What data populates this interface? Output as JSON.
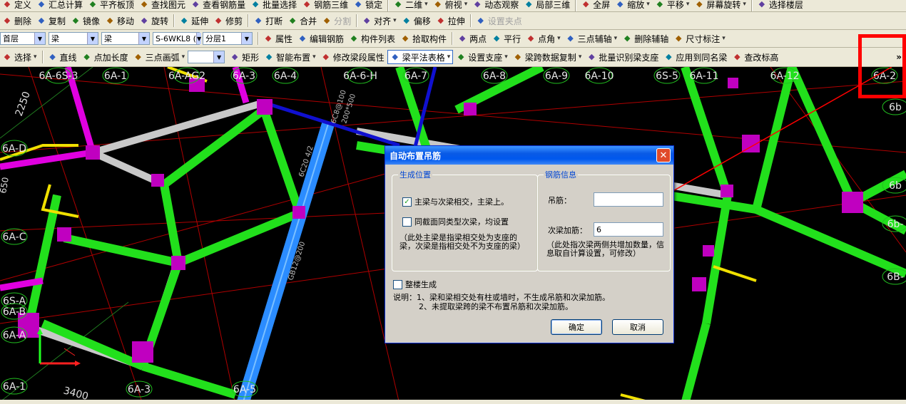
{
  "toolbar_top": {
    "items": [
      "定义",
      "汇总计算",
      "平齐板顶",
      "查找图元",
      "查看钢筋量",
      "批量选择",
      "钢筋三维",
      "锁定",
      "二维",
      "俯视",
      "动态观察",
      "局部三维",
      "全屏",
      "缩放",
      "平移",
      "屏幕旋转",
      "选择楼层"
    ]
  },
  "toolbar_edit": {
    "items": [
      "删除",
      "复制",
      "镜像",
      "移动",
      "旋转",
      "延伸",
      "修剪",
      "打断",
      "合并",
      "分割",
      "对齐",
      "偏移",
      "拉伸",
      "设置夹点"
    ]
  },
  "toolbar_props": {
    "combos": [
      "首层",
      "梁",
      "梁",
      "S-6WKL8 (",
      "分层1"
    ],
    "items": [
      "属性",
      "编辑钢筋",
      "构件列表",
      "拾取构件",
      "两点",
      "平行",
      "点角",
      "三点辅轴",
      "删除辅轴",
      "尺寸标注"
    ]
  },
  "toolbar_draw": {
    "items": [
      "选择",
      "直线",
      "点加长度",
      "三点画弧",
      "矩形",
      "智能布置",
      "修改梁段属性",
      "梁平法表格",
      "设置支座",
      "梁跨数据复制",
      "批量识别梁支座",
      "应用到同名梁",
      "查改标高"
    ],
    "overflow": "»"
  },
  "canvas": {
    "axis_labels_top": [
      "6A-6S-3",
      "6A-1",
      "6A-AG2",
      "6A-3",
      "6A-4",
      "6A-6-H",
      "6A-7",
      "6A-8",
      "6A-9",
      "6A-10",
      "6S-5",
      "6A-11",
      "6A-12",
      "6A-2"
    ],
    "axis_labels_left": [
      "6A-D",
      "6A-C",
      "6S-A",
      "6A-B",
      "6A-A",
      "6A-1"
    ],
    "axis_labels_right": [
      "6b",
      "6b",
      "6b-",
      "6B-"
    ],
    "axis_labels_bottom": [
      "6A-3",
      "6A-5"
    ],
    "dimensions": [
      "2250",
      "3400",
      "650"
    ],
    "beam_texts": [
      "GB12@200",
      "6C20 4/2",
      "200*500",
      "6C8@100"
    ]
  },
  "dialog": {
    "title": "自动布置吊筋",
    "group_position": {
      "legend": "生成位置",
      "option1": "主梁与次梁相交，主梁上。",
      "option1_checked": true,
      "option2": "同截面同类型次梁，均设置",
      "option2_checked": false,
      "note": "（此处主梁是指梁相交处为支座的梁，次梁是指相交处不为支座的梁）"
    },
    "group_rebar": {
      "legend": "钢筋信息",
      "hanger_label": "吊筋：",
      "hanger_value": "",
      "stirrup_label": "次梁加筋：",
      "stirrup_value": "6",
      "note": "（此处指次梁两侧共增加数量，信息取自计算设置，可修改）"
    },
    "whole_floor_label": "整楼生成",
    "whole_floor_checked": false,
    "explanation_line1": "说明：1、梁和梁相交处有柱或墙时，不生成吊筋和次梁加筋。",
    "explanation_line2": "2、未提取梁跨的梁不布置吊筋和次梁加筋。",
    "ok_label": "确定",
    "cancel_label": "取消"
  },
  "colors": {
    "highlight_box": "#ff0000",
    "beam_green": "#22e01c",
    "beam_magenta": "#e000e0",
    "beam_blue": "#2b8cff",
    "beam_gray": "#c8c8c8",
    "beam_yellow": "#f0e000"
  }
}
